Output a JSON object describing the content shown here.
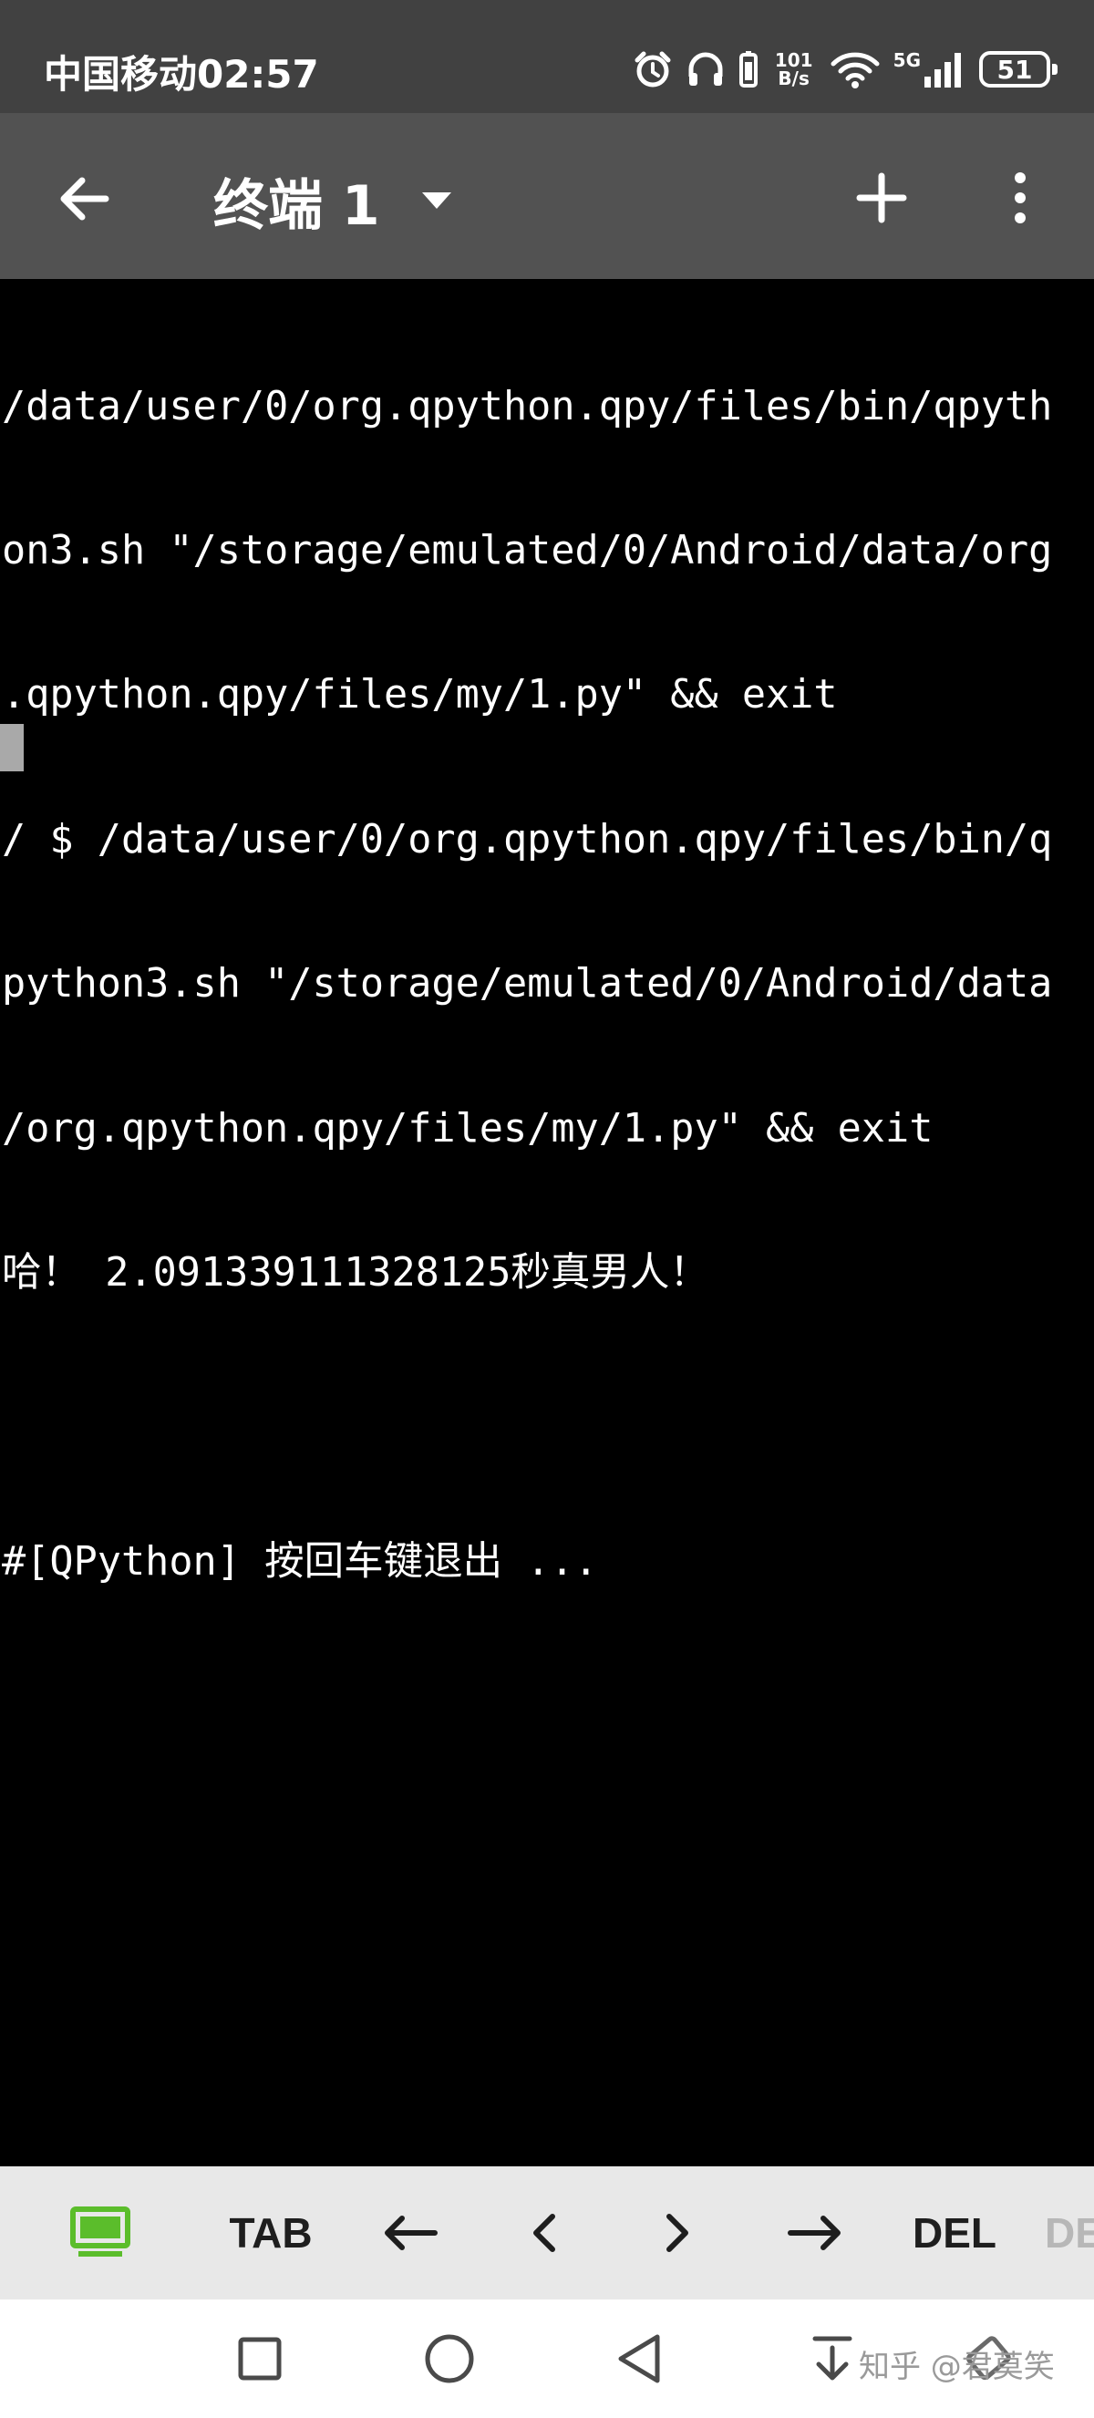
{
  "status_bar": {
    "carrier_time": "中国移动02:57",
    "net_speed_value": "101",
    "net_speed_unit": "B/s",
    "signal_label": "5G",
    "battery_level": "51",
    "icons": [
      "alarm-icon",
      "headphones-icon",
      "vibrate-icon",
      "wifi-icon",
      "signal-icon",
      "battery-icon"
    ]
  },
  "app_bar": {
    "title": "终端 1",
    "icons": [
      "back-arrow-icon",
      "dropdown-icon",
      "add-icon",
      "more-vert-icon"
    ]
  },
  "terminal": {
    "lines": [
      "/data/user/0/org.qpython.qpy/files/bin/qpyth",
      "on3.sh \"/storage/emulated/0/Android/data/org",
      ".qpython.qpy/files/my/1.py\" && exit",
      "/ $ /data/user/0/org.qpython.qpy/files/bin/q",
      "python3.sh \"/storage/emulated/0/Android/data",
      "/org.qpython.qpy/files/my/1.py\" && exit",
      "哈！ 2.091339111328125秒真男人！",
      "",
      "#[QPython] 按回车键退出 ..."
    ]
  },
  "keys_bar": {
    "keys": [
      "TAB",
      "←",
      "<",
      ">",
      "→",
      "DEL",
      "DE"
    ],
    "colors": {
      "keyboard_icon": "#5bbd2b",
      "background": "#e8e8e8"
    }
  },
  "nav_bar": {
    "watermark": "知乎 @君莫笑",
    "icons": [
      "recents-square-icon",
      "home-circle-icon",
      "back-triangle-icon",
      "collapse-down-icon",
      "rotate-screen-icon"
    ]
  },
  "colors": {
    "status_bar_bg": "#414141",
    "app_bar_bg": "#525252",
    "terminal_bg": "#000000",
    "terminal_fg": "#ffffff",
    "cursor": "#a9a9a9"
  }
}
